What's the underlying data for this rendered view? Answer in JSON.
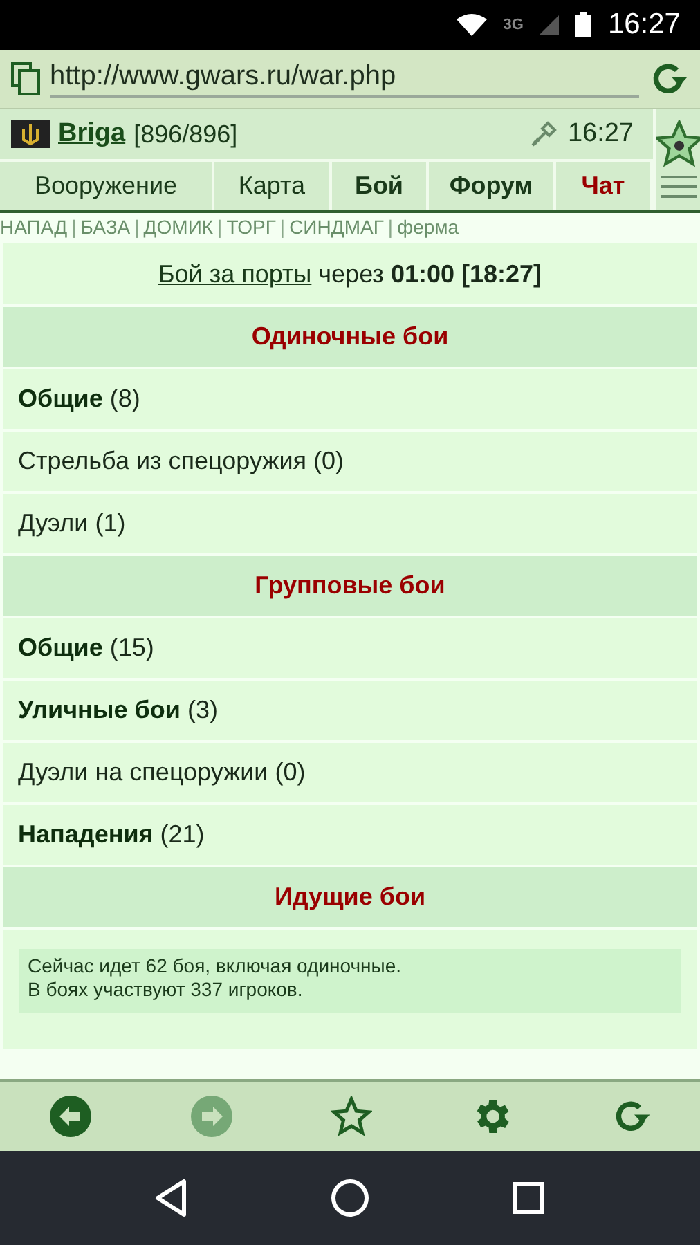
{
  "status_bar": {
    "network": "3G",
    "time": "16:27"
  },
  "browser": {
    "url": "http://www.gwars.ru/war.php"
  },
  "header": {
    "user": "Briga",
    "hp": "[896/896]",
    "time": "16:27"
  },
  "nav_tabs": [
    {
      "label": "Вооружение",
      "kind": "normal"
    },
    {
      "label": "Карта",
      "kind": "normal"
    },
    {
      "label": "Бой",
      "kind": "bold"
    },
    {
      "label": "Форум",
      "kind": "bold"
    },
    {
      "label": "Чат",
      "kind": "alert"
    }
  ],
  "quick_links": {
    "separator": "|",
    "items": [
      "НАПАД",
      "БАЗА",
      "ДОМИК",
      "ТОРГ",
      "СИНДМАГ",
      "ферма"
    ]
  },
  "announcement": {
    "link": "Бой за порты",
    "text": "через",
    "time": "01:00 [18:27]"
  },
  "sections": [
    {
      "title": "Одиночные бои",
      "items": [
        {
          "name": "Общие",
          "count": "(8)",
          "bold": true
        },
        {
          "name": "Стрельба из спецоружия",
          "count": "(0)",
          "bold": false
        },
        {
          "name": "Дуэли",
          "count": "(1)",
          "bold": false
        }
      ]
    },
    {
      "title": "Групповые бои",
      "items": [
        {
          "name": "Общие",
          "count": "(15)",
          "bold": true
        },
        {
          "name": "Уличные бои",
          "count": "(3)",
          "bold": true
        },
        {
          "name": "Дуэли на спецоружии",
          "count": "(0)",
          "bold": false
        },
        {
          "name": "Нападения",
          "count": "(21)",
          "bold": true
        }
      ]
    },
    {
      "title": "Идущие бои",
      "info": [
        "Сейчас идет 62 боя, включая одиночные.",
        "В боях участвуют 337 игроков."
      ]
    }
  ],
  "toolbar": [
    {
      "kind": "back",
      "disabled": false
    },
    {
      "kind": "forward",
      "disabled": true
    },
    {
      "kind": "star",
      "disabled": false
    },
    {
      "kind": "settings",
      "disabled": false
    },
    {
      "kind": "reload",
      "disabled": false
    }
  ]
}
